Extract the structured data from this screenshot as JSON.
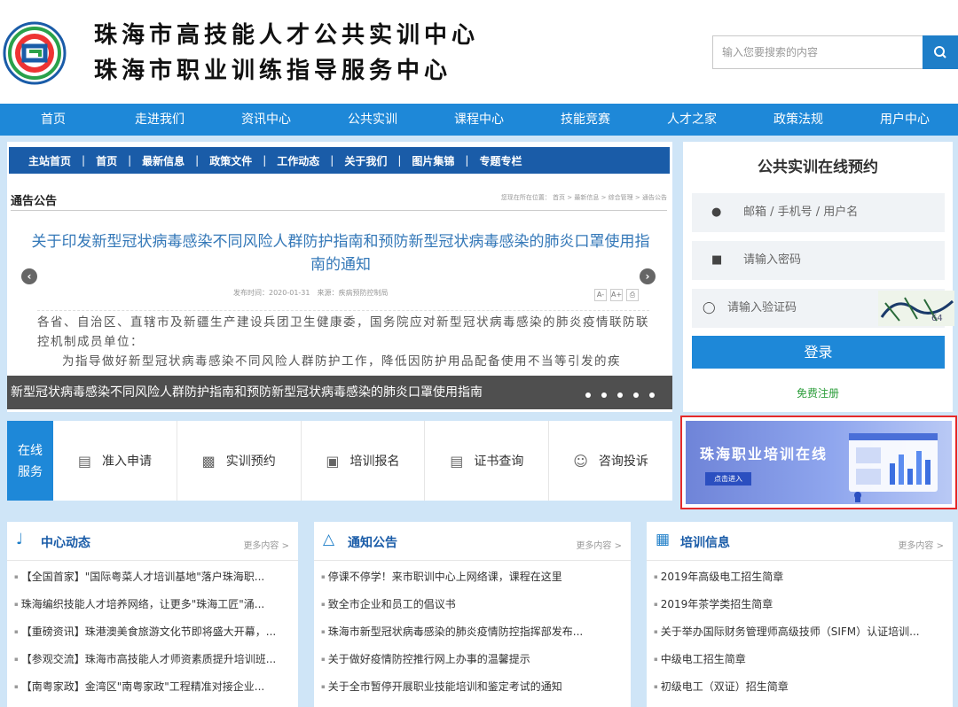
{
  "header": {
    "title_line1": "珠海市高技能人才公共实训中心",
    "title_line2": "珠海市职业训练指导服务中心",
    "search_placeholder": "输入您要搜索的内容"
  },
  "nav": [
    "首页",
    "走进我们",
    "资讯中心",
    "公共实训",
    "课程中心",
    "技能竞赛",
    "人才之家",
    "政策法规",
    "用户中心"
  ],
  "slider": {
    "subnav": [
      "主站首页",
      "首页",
      "最新信息",
      "政策文件",
      "工作动态",
      "关于我们",
      "图片集锦",
      "专题专栏"
    ],
    "section_title": "通告公告",
    "breadcrumb": "您现在所在位置： 首页 > 最新信息 > 综合管理 > 通告公告",
    "article_title": "关于印发新型冠状病毒感染不同风险人群防护指南和预防新型冠状病毒感染的肺炎口罩使用指南的通知",
    "publish_meta": "发布时间：2020-01-31　来源：疾病预防控制局",
    "body_line1": "各省、自治区、直辖市及新疆生产建设兵团卫生健康委，国务院应对新型冠状病毒感染的肺炎疫情联防联控机制成员单位：",
    "body_line2": "为指导做好新型冠状病毒感染不同风险人群防护工作，降低因防护用品配备使用不当等引发的疾",
    "caption": "新型冠状病毒感染不同风险人群防护指南和预防新型冠状病毒感染的肺炎口罩使用指南",
    "font_tools": [
      "A-",
      "A+",
      "⎙"
    ]
  },
  "login": {
    "title": "公共实训在线预约",
    "username_placeholder": "邮箱 / 手机号 / 用户名",
    "password_placeholder": "请输入密码",
    "captcha_placeholder": "请输入验证码",
    "login_button": "登录",
    "register_link": "免费注册"
  },
  "services": {
    "label_line1": "在线",
    "label_line2": "服务",
    "items": [
      "准入申请",
      "实训预约",
      "培训报名",
      "证书查询",
      "咨询投诉"
    ]
  },
  "banner": {
    "title": "珠海职业培训在线",
    "button": "点击进入"
  },
  "panels": [
    {
      "title": "中心动态",
      "more": "更多内容 >",
      "items": [
        "【全国首家】\"国际粤菜人才培训基地\"落户珠海职...",
        "珠海编织技能人才培养网络，让更多\"珠海工匠\"涌...",
        "【重磅资讯】珠港澳美食旅游文化节即将盛大开幕，...",
        "【参观交流】珠海市高技能人才师资素质提升培训班...",
        "【南粤家政】金湾区\"南粤家政\"工程精准对接企业..."
      ]
    },
    {
      "title": "通知公告",
      "more": "更多内容 >",
      "items": [
        "停课不停学！来市职训中心上网络课，课程在这里",
        "致全市企业和员工的倡议书",
        "珠海市新型冠状病毒感染的肺炎疫情防控指挥部发布...",
        "关于做好疫情防控推行网上办事的温馨提示",
        "关于全市暂停开展职业技能培训和鉴定考试的通知"
      ]
    },
    {
      "title": "培训信息",
      "more": "更多内容 >",
      "items": [
        "2019年高级电工招生简章",
        "2019年茶学类招生简章",
        "关于举办国际财务管理师高级技师（SIFM）认证培训...",
        "中级电工招生简章",
        "初级电工（双证）招生简章"
      ]
    }
  ]
}
